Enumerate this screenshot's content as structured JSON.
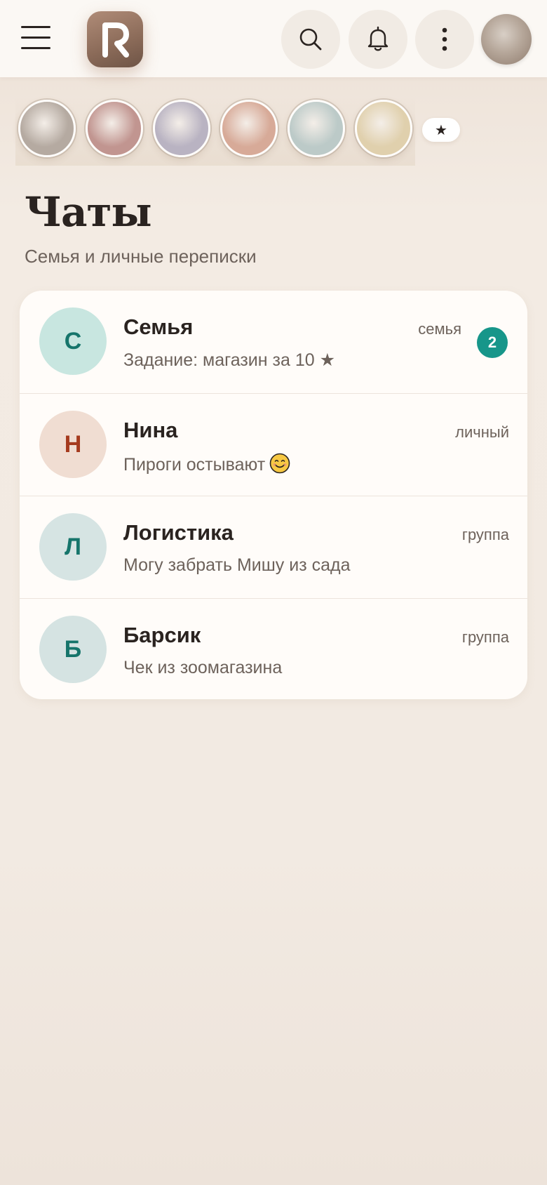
{
  "header": {
    "logo_letter": "R",
    "menu_icon": "hamburger-menu-icon",
    "search_icon": "search-icon",
    "notifications_icon": "bell-icon",
    "more_icon": "more-vertical-icon"
  },
  "stories": {
    "items": [
      {
        "color": "#b5aaa1"
      },
      {
        "color": "#c19590"
      },
      {
        "color": "#b9b3c2"
      },
      {
        "color": "#d7aa98"
      },
      {
        "color": "#bccac8"
      },
      {
        "color": "#e0d0ad"
      }
    ],
    "favorite_label": "★"
  },
  "page": {
    "title": "Чаты",
    "subtitle": "Семья и личные переписки"
  },
  "chats": [
    {
      "initial": "С",
      "name": "Семья",
      "preview": "Задание: магазин за 10 ★",
      "tag": "семья",
      "unread": "2",
      "avatar_bg": "#c8e6e0",
      "avatar_fg": "#16756b"
    },
    {
      "initial": "Н",
      "name": "Нина",
      "preview": "Пироги остывают",
      "preview_emoji": "😊",
      "tag": "личный",
      "avatar_bg": "#f0ddd2",
      "avatar_fg": "#a53a1e"
    },
    {
      "initial": "Л",
      "name": "Логистика",
      "preview": "Могу забрать Мишу из сада",
      "tag": "группа",
      "avatar_bg": "#d6e4e3",
      "avatar_fg": "#16756b"
    },
    {
      "initial": "Б",
      "name": "Барсик",
      "preview": "Чек из зоомагазина",
      "tag": "группа",
      "avatar_bg": "#d5e3e2",
      "avatar_fg": "#16756b"
    }
  ],
  "colors": {
    "accent": "#17968a",
    "text_primary": "#2a2320",
    "text_secondary": "#6d625b",
    "card_bg": "#fffcf9"
  }
}
